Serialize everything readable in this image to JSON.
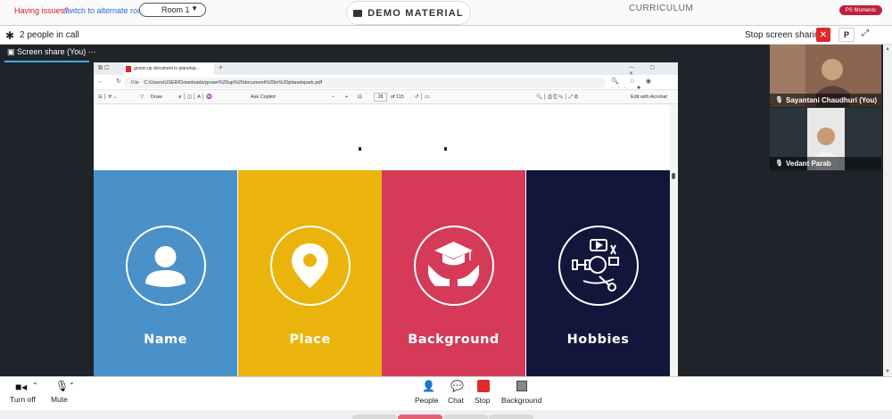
{
  "topbar": {
    "issues_text": "Having issues?",
    "switch_link": "switch to alternate room",
    "room_value": "Room 1",
    "demo_label": "DEMO MATERIAL",
    "curriculum_label": "CURRICULUM",
    "moments_label": "PS Moments"
  },
  "call": {
    "people_count": "2 people in call",
    "stop_sharing": "Stop screen sharing",
    "close_glyph": "✕",
    "p_label": "P",
    "expand_glyph": "⤢"
  },
  "stage": {
    "tab_label": "Screen share (You)",
    "tab_menu": "···"
  },
  "browser": {
    "tab_title": "grown up document in planetsp...",
    "new_tab": "+",
    "address_prefix": "File",
    "address": "C:/Users/USER/Downloads/grown%20up%20document%20in%20planetspark.pdf",
    "toolbar": {
      "draw": "Draw",
      "ask_copilot": "Ask Copilot",
      "minus": "−",
      "plus": "+",
      "page_current": "28",
      "page_total": "of 115",
      "edit_acrobat": "Edit with Acrobat"
    }
  },
  "pdf": {
    "columns": [
      {
        "label": "Name",
        "icon": "person-icon",
        "color": "#4a90c9"
      },
      {
        "label": "Place",
        "icon": "location-pin-icon",
        "color": "#ebb40c"
      },
      {
        "label": "Background",
        "icon": "graduation-hands-icon",
        "color": "#d53a59"
      },
      {
        "label": "Hobbies",
        "icon": "hobbies-icon",
        "color": "#12163a"
      }
    ]
  },
  "participants": [
    {
      "name": "Sayantani Chaudhuri (You)"
    },
    {
      "name": "Vedant Parab"
    }
  ],
  "controls": {
    "turn_off": "Turn off",
    "mute": "Mute",
    "people": "People",
    "chat": "Chat",
    "stop": "Stop",
    "background": "Background"
  }
}
